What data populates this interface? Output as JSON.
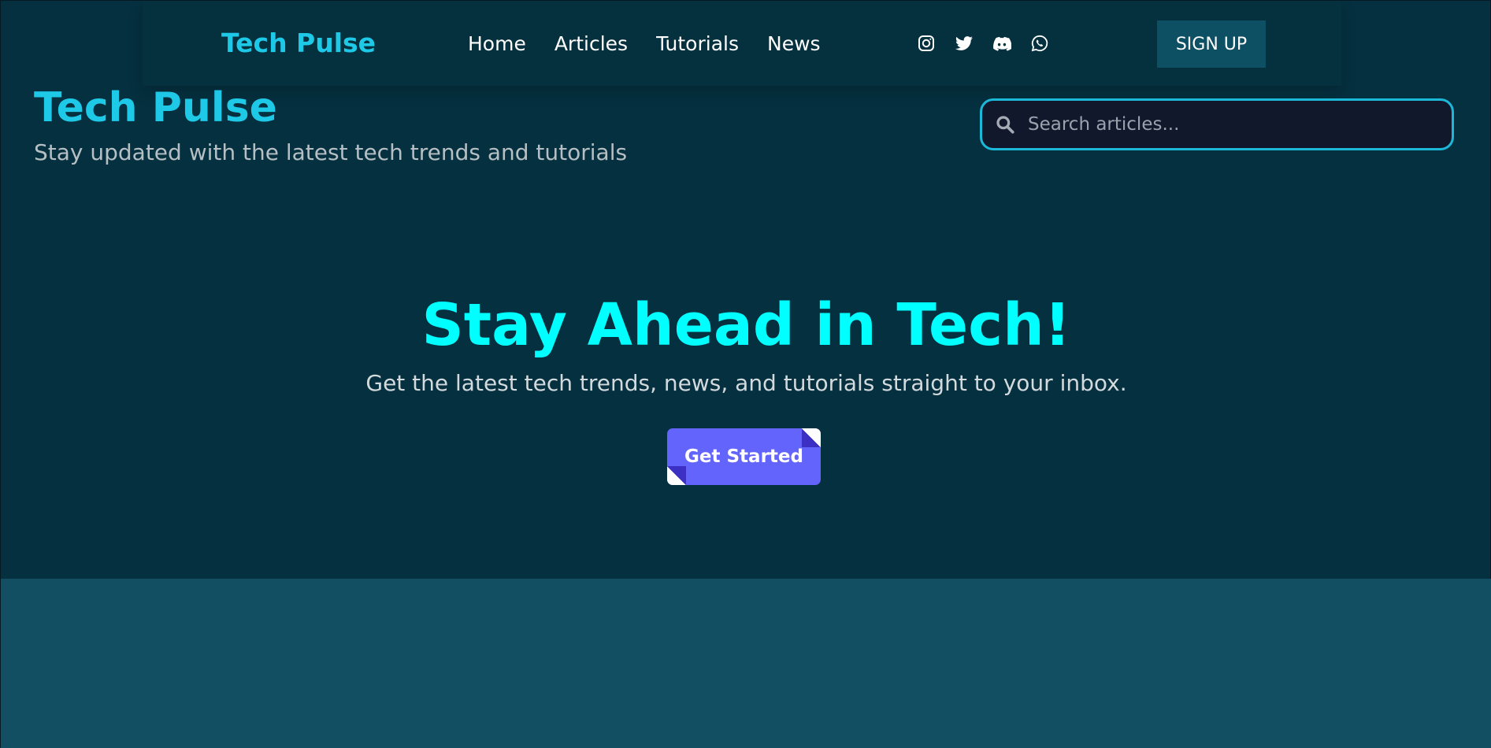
{
  "navbar": {
    "brand": "Tech Pulse",
    "links": [
      "Home",
      "Articles",
      "Tutorials",
      "News"
    ],
    "social_icons": [
      "instagram-icon",
      "twitter-icon",
      "discord-icon",
      "whatsapp-icon"
    ],
    "signup_label": "SIGN UP"
  },
  "header": {
    "title": "Tech Pulse",
    "tagline": "Stay updated with the latest tech trends and tutorials"
  },
  "search": {
    "placeholder": "Search articles...",
    "icon": "search-icon"
  },
  "hero": {
    "heading": "Stay Ahead in Tech!",
    "subheading": "Get the latest tech trends, news, and tutorials straight to your inbox.",
    "cta_label": "Get Started"
  },
  "colors": {
    "background": "#05303f",
    "accent": "#1ec9e8",
    "hero_heading": "#00ffff",
    "cta": "#6364fb",
    "signup_button": "#0d4f63",
    "lower_section": "#124f63"
  }
}
